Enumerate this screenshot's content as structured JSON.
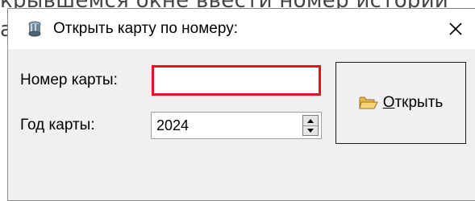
{
  "background": {
    "line1": "крывшемся окне ввести номер истории",
    "line2": "а"
  },
  "dialog": {
    "title": "Открыть карту по номеру:",
    "close_glyph": "✕",
    "card_number_label": "Номер карты:",
    "card_number_value": "",
    "card_year_label": "Год карты:",
    "card_year_value": "2024",
    "open_button": {
      "mnemonic": "О",
      "rest": "ткрыть"
    }
  },
  "colors": {
    "error_border": "#e81123",
    "dialog_bg": "#f0f0f0",
    "titlebar_bg": "#ffffff"
  },
  "icons": {
    "title": "app-cylinder-icon",
    "close": "close-icon",
    "spin_up": "arrow-up-icon",
    "spin_down": "arrow-down-icon",
    "open": "open-folder-icon"
  }
}
